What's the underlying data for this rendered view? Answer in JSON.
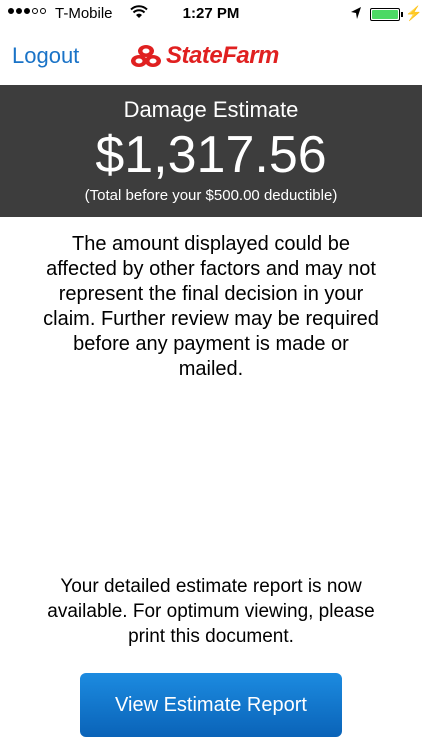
{
  "status_bar": {
    "carrier": "T-Mobile",
    "time": "1:27 PM",
    "signal_bars_filled": 3,
    "signal_bars_total": 5
  },
  "nav": {
    "logout_label": "Logout",
    "logo_text": "StateFarm"
  },
  "estimate": {
    "title": "Damage Estimate",
    "amount": "$1,317.56",
    "subtitle": "(Total before your $500.00 deductible)"
  },
  "disclaimer": "The amount displayed could be affected by other factors and may not represent the final decision in your claim. Further review may be required before any payment is made or mailed.",
  "report_note": "Your detailed estimate report is now available. For optimum viewing, please print this document.",
  "view_button_label": "View Estimate Report",
  "colors": {
    "accent": "#1a73c7",
    "brand_red": "#e02020",
    "header_bg": "#3d3d3d",
    "button_blue": "#0a63b8"
  }
}
